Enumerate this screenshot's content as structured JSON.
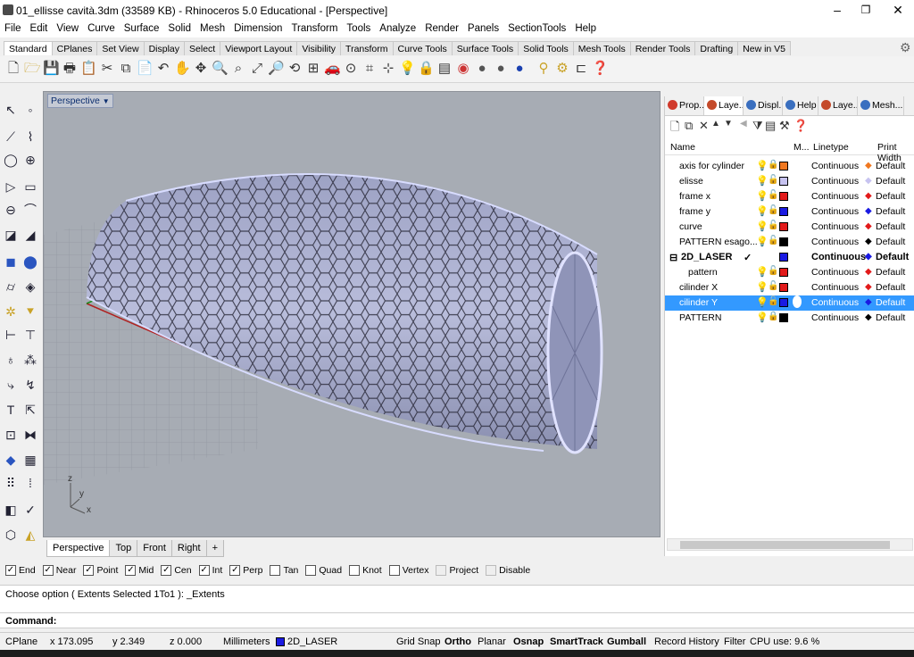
{
  "window": {
    "title": "01_ellisse cavità.3dm (33589 KB) - Rhinoceros 5.0 Educational - [Perspective]",
    "minimize": "–",
    "restore": "❐",
    "close": "✕"
  },
  "menu": [
    "File",
    "Edit",
    "View",
    "Curve",
    "Surface",
    "Solid",
    "Mesh",
    "Dimension",
    "Transform",
    "Tools",
    "Analyze",
    "Render",
    "Panels",
    "SectionTools",
    "Help"
  ],
  "toolbar_tabs": [
    "Standard",
    "CPlanes",
    "Set View",
    "Display",
    "Select",
    "Viewport Layout",
    "Visibility",
    "Transform",
    "Curve Tools",
    "Surface Tools",
    "Solid Tools",
    "Mesh Tools",
    "Render Tools",
    "Drafting",
    "New in V5"
  ],
  "viewport": {
    "label": "Perspective",
    "axis_x": "x",
    "axis_y": "y",
    "axis_z": "z"
  },
  "view_tabs": [
    "Perspective",
    "Top",
    "Front",
    "Right"
  ],
  "view_tab_add": "+",
  "panel": {
    "tabs": [
      "Prop...",
      "Laye...",
      "Displ...",
      "Help",
      "Laye...",
      "Mesh..."
    ],
    "tab_colors": [
      "#d03a2c",
      "#c44a2a",
      "#3a6fbf",
      "#3a6fbf",
      "#c44a2a",
      "#3a6fbf"
    ],
    "headers": {
      "name": "Name",
      "material": "M...",
      "linetype": "Linetype",
      "printwidth": "Print Width"
    },
    "layers": [
      {
        "name": "axis for cylinder",
        "color": "#f07820",
        "lock": "🔒",
        "linetype": "Continuous",
        "printwidth": "Default",
        "indent": 0
      },
      {
        "name": "elisse",
        "color": "#c7c3f0",
        "lock": "🔓",
        "linetype": "Continuous",
        "printwidth": "Default",
        "indent": 0
      },
      {
        "name": "frame x",
        "color": "#e21a1a",
        "lock": "🔓",
        "linetype": "Continuous",
        "printwidth": "Default",
        "indent": 0
      },
      {
        "name": "frame y",
        "color": "#1a1ae2",
        "lock": "🔓",
        "linetype": "Continuous",
        "printwidth": "Default",
        "indent": 0
      },
      {
        "name": "curve",
        "color": "#e21a1a",
        "lock": "🔓",
        "linetype": "Continuous",
        "printwidth": "Default",
        "indent": 0
      },
      {
        "name": "PATTERN esago...",
        "color": "#000000",
        "lock": "🔓",
        "linetype": "Continuous",
        "printwidth": "Default",
        "indent": 0
      },
      {
        "name": "2D_LASER",
        "color": "#1a1ae2",
        "lock": "",
        "linetype": "Continuous",
        "printwidth": "Default",
        "indent": 0,
        "current": "✓",
        "expander": "⊟"
      },
      {
        "name": "pattern",
        "color": "#e21a1a",
        "lock": "🔓",
        "linetype": "Continuous",
        "printwidth": "Default",
        "indent": 1
      },
      {
        "name": "cilinder X",
        "color": "#e21a1a",
        "lock": "🔓",
        "linetype": "Continuous",
        "printwidth": "Default",
        "indent": 0
      },
      {
        "name": "cilinder Y",
        "color": "#1a1ae2",
        "lock": "🔓",
        "linetype": "Continuous",
        "printwidth": "Default",
        "indent": 0,
        "selected": true
      },
      {
        "name": "PATTERN",
        "color": "#000000",
        "lock": "🔒",
        "linetype": "Continuous",
        "printwidth": "Default",
        "indent": 0
      }
    ],
    "diamond_colors": [
      "#f07820",
      "#c7c3f0",
      "#e21a1a",
      "#1a1ae2",
      "#e21a1a",
      "#000000",
      "#1a1ae2",
      "#e21a1a",
      "#e21a1a",
      "#1a1ae2",
      "#000000"
    ]
  },
  "osnaps": [
    {
      "label": "End",
      "checked": true
    },
    {
      "label": "Near",
      "checked": true
    },
    {
      "label": "Point",
      "checked": true
    },
    {
      "label": "Mid",
      "checked": true
    },
    {
      "label": "Cen",
      "checked": true
    },
    {
      "label": "Int",
      "checked": true
    },
    {
      "label": "Perp",
      "checked": true
    },
    {
      "label": "Tan",
      "checked": false
    },
    {
      "label": "Quad",
      "checked": false
    },
    {
      "label": "Knot",
      "checked": false
    },
    {
      "label": "Vertex",
      "checked": false
    },
    {
      "label": "Project",
      "checked": false,
      "disabled": true
    },
    {
      "label": "Disable",
      "checked": false,
      "disabled": true
    }
  ],
  "command": {
    "history": "Choose option ( Extents  Selected  1To1 ): _Extents",
    "prompt": "Command:"
  },
  "status": {
    "cplane": "CPlane",
    "x": "x 173.095",
    "y": "y 2.349",
    "z": "z 0.000",
    "units": "Millimeters",
    "layer": "2D_LASER",
    "layer_color": "#1a1ae2",
    "grid_snap": "Grid Snap",
    "ortho": "Ortho",
    "planar": "Planar",
    "osnap": "Osnap",
    "smarttrack": "SmartTrack",
    "gumball": "Gumball",
    "record_history": "Record History",
    "filter": "Filter",
    "cpu": "CPU use: 9.6 %"
  }
}
